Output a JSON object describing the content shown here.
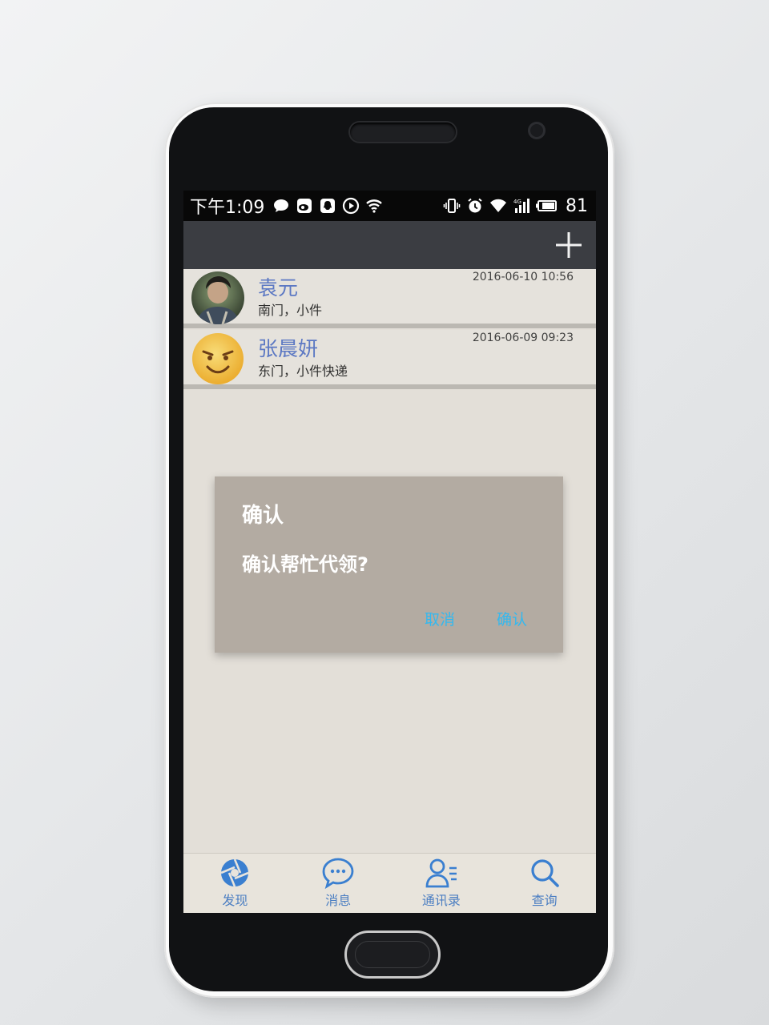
{
  "status_bar": {
    "time": "下午1:09",
    "battery": "81",
    "left_icons": [
      "message-icon",
      "weibo-icon",
      "qq-icon",
      "play-icon",
      "wifi-icon"
    ],
    "right_icons": [
      "vibrate-icon",
      "alarm-icon",
      "wifi-icon",
      "signal-4g-icon",
      "battery-icon"
    ]
  },
  "header": {
    "add_icon": "plus-icon"
  },
  "contacts": [
    {
      "name": "袁元",
      "desc": "南门，小件",
      "time": "2016-06-10 10:56",
      "avatar": "photo-avatar"
    },
    {
      "name": "张晨妍",
      "desc": "东门，小件快递",
      "time": "2016-06-09 09:23",
      "avatar": "smiley-avatar"
    }
  ],
  "dialog": {
    "title": "确认",
    "message": "确认帮忙代领?",
    "cancel": "取消",
    "confirm": "确认"
  },
  "tabs": [
    {
      "label": "发现",
      "icon": "aperture-icon"
    },
    {
      "label": "消息",
      "icon": "chat-bubble-icon"
    },
    {
      "label": "通讯录",
      "icon": "contacts-icon"
    },
    {
      "label": "查询",
      "icon": "search-icon"
    }
  ],
  "colors": {
    "accent": "#4b7ec2",
    "name": "#5b79c9",
    "dialog_button": "#33b8ef",
    "header": "#3b3d42"
  }
}
